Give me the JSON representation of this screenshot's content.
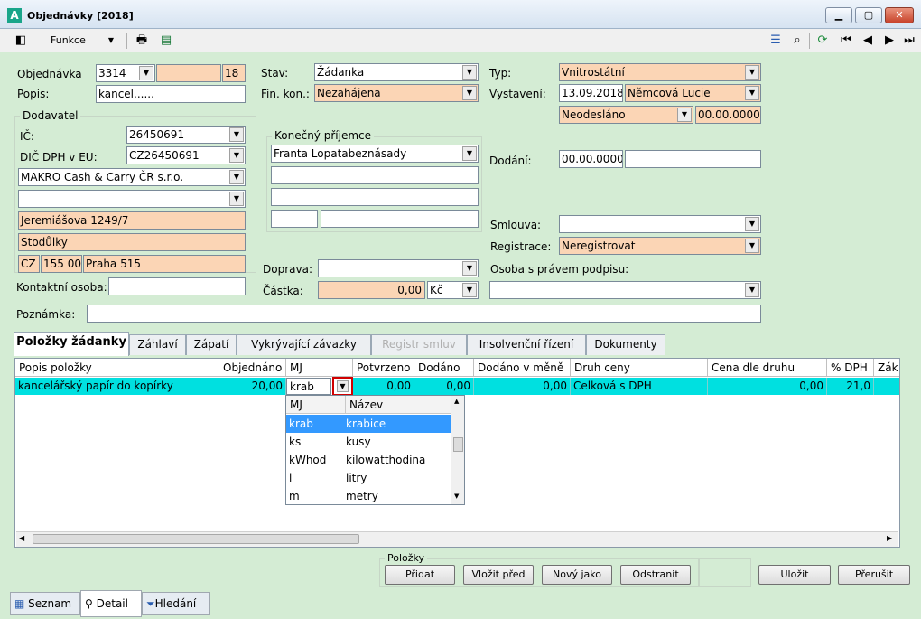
{
  "window": {
    "title": "Objednávky [2018]",
    "logo": "A"
  },
  "toolbar": {
    "funkce_label": "Funkce"
  },
  "order": {
    "objednavka_label": "Objednávka",
    "objednavka_value": "3314",
    "objednavka_suffix": "18",
    "popis_label": "Popis:",
    "popis_value": "kancel......",
    "stav_label": "Stav:",
    "stav_value": "Žádanka",
    "finkon_label": "Fin. kon.:",
    "finkon_value": "Nezahájena",
    "typ_label": "Typ:",
    "typ_value": "Vnitrostátní",
    "vystaveni_label": "Vystavení:",
    "vystaveni_date": "13.09.2018",
    "vystaveni_person": "Němcová Lucie",
    "odeslano_value": "Neodesláno",
    "odeslano_date": "00.00.0000"
  },
  "supplier": {
    "group_title": "Dodavatel",
    "ic_label": "IČ:",
    "ic_value": "26450691",
    "dic_label": "DIČ DPH v EU:",
    "dic_value": "CZ26450691",
    "name_value": "MAKRO Cash & Carry ČR s.r.o.",
    "street": "Jeremiášova 1249/7",
    "district": "Stodůlky",
    "country": "CZ",
    "zip": "155 00",
    "city": "Praha 515",
    "contact_label": "Kontaktní osoba:"
  },
  "recipient": {
    "group_title": "Konečný příjemce",
    "name_value": "Franta Lopatabeznásady"
  },
  "delivery": {
    "dodani_label": "Dodání:",
    "dodani_date": "00.00.0000",
    "doprava_label": "Doprava:",
    "castka_label": "Částka:",
    "castka_value": "0,00",
    "currency": "Kč",
    "smlouva_label": "Smlouva:",
    "registrace_label": "Registrace:",
    "registrace_value": "Neregistrovat",
    "osoba_label": "Osoba s právem podpisu:",
    "poznamka_label": "Poznámka:"
  },
  "tabs": [
    "Položky žádanky",
    "Záhlaví",
    "Zápatí",
    "Vykrývající závazky",
    "Registr smluv",
    "Insolvenční řízení",
    "Dokumenty"
  ],
  "grid": {
    "headers": [
      "Popis položky",
      "Objednáno",
      "MJ",
      "Potvrzeno",
      "Dodáno",
      "Dodáno v měně",
      "Druh ceny",
      "Cena dle druhu",
      "% DPH",
      "Zák"
    ],
    "row": {
      "popis": "kancelářský papír do kopírky",
      "objednano": "20,00",
      "mj": "krab",
      "potvrzeno": "0,00",
      "dodano": "0,00",
      "dodano_mena": "0,00",
      "druh_ceny": "Celková s DPH",
      "cena": "0,00",
      "dph": "21,0"
    }
  },
  "mj_popup": {
    "headers": [
      "MJ",
      "Název"
    ],
    "rows": [
      {
        "mj": "krab",
        "nazev": "krabice"
      },
      {
        "mj": "ks",
        "nazev": "kusy"
      },
      {
        "mj": "kWhod",
        "nazev": "kilowatthodina"
      },
      {
        "mj": "l",
        "nazev": "litry"
      },
      {
        "mj": "m",
        "nazev": "metry"
      }
    ]
  },
  "items_actions": {
    "group_title": "Položky",
    "pridat": "Přidat",
    "vlozit_pred": "Vložit před",
    "novy_jako": "Nový jako",
    "odstranit": "Odstranit"
  },
  "form_actions": {
    "ulozit": "Uložit",
    "prerusit": "Přerušit"
  },
  "bottom_tabs": {
    "seznam": "Seznam",
    "detail": "Detail",
    "hledani": "Hledání"
  },
  "colors": {
    "background": "#d4ecd4",
    "peach": "#fbd5b5",
    "row_highlight": "#00e0e0",
    "selection": "#3399ff",
    "highlight_border": "#d00000"
  }
}
